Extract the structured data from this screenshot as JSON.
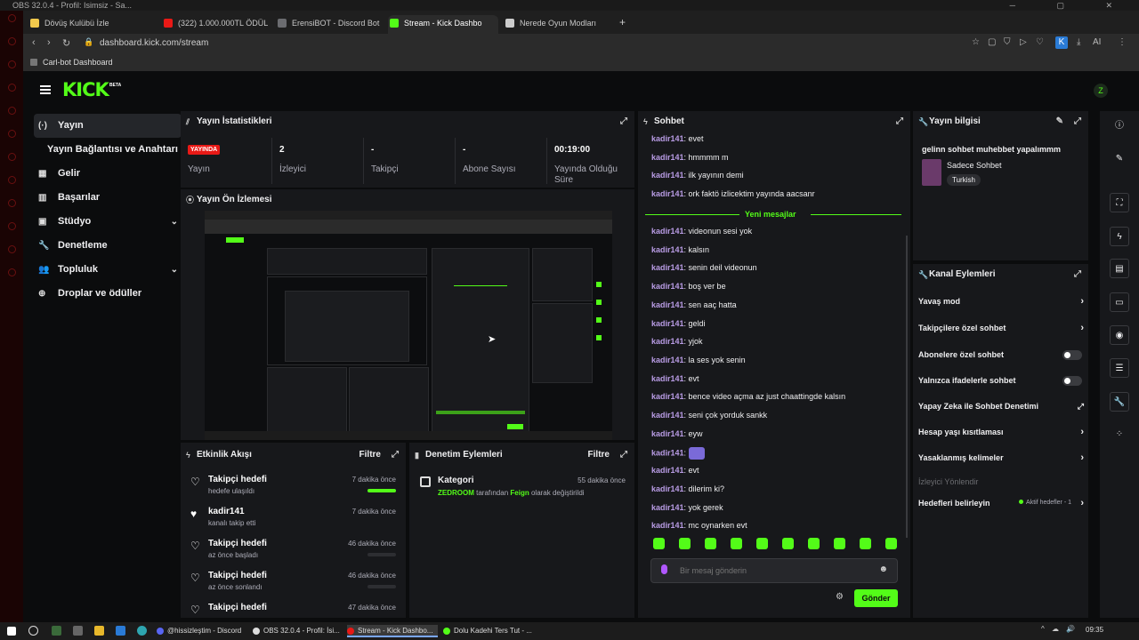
{
  "window_title": "OBS 32.0.4 - Profil: Isimsiz - Sa...",
  "browser": {
    "tabs": [
      {
        "label": "Dövüş Kulübü İzle",
        "color": "#f2c94c"
      },
      {
        "label": "(322) 1.000.000TL ÖDÜL",
        "color": "#e91916"
      },
      {
        "label": "ErensiBOT - Discord Bot",
        "color": "#6b6c70"
      },
      {
        "label": "Stream - Kick Dashbo",
        "color": "#53fc18"
      },
      {
        "label": "Nerede Oyun Modları",
        "color": "#cccccc"
      }
    ],
    "new_tab": "+",
    "url": "dashboard.kick.com/stream",
    "bookmark": "Carl-bot Dashboard"
  },
  "app": {
    "logo": "KICK",
    "beta": "BETA",
    "avatar_initial": "Z"
  },
  "sidebar": {
    "items": [
      {
        "label": "Yayın",
        "icon": "(·)",
        "active": true,
        "sub": false,
        "chevron": false
      },
      {
        "label": "Yayın Bağlantısı ve Anahtarı",
        "icon": "",
        "active": false,
        "sub": true,
        "chevron": false
      },
      {
        "label": "Gelir",
        "icon": "▦",
        "active": false,
        "sub": false,
        "chevron": false
      },
      {
        "label": "Başarılar",
        "icon": "▥",
        "active": false,
        "sub": false,
        "chevron": false
      },
      {
        "label": "Stüdyo",
        "icon": "▣",
        "active": false,
        "sub": false,
        "chevron": true
      },
      {
        "label": "Denetleme",
        "icon": "🔧",
        "active": false,
        "sub": false,
        "chevron": false
      },
      {
        "label": "Topluluk",
        "icon": "👥",
        "active": false,
        "sub": false,
        "chevron": true
      },
      {
        "label": "Droplar ve ödüller",
        "icon": "⊕",
        "active": false,
        "sub": false,
        "chevron": false
      }
    ]
  },
  "stats": {
    "title": "Yayın İstatistikleri",
    "live_badge": "YAYINDA",
    "items": [
      {
        "value": "2",
        "label": "İzleyici"
      },
      {
        "value": "-",
        "label": "Takipçi"
      },
      {
        "value": "-",
        "label": "Abone Sayısı"
      },
      {
        "value": "00:19:00",
        "label": "Yayında Olduğu Süre"
      }
    ],
    "live_label": "Yayın"
  },
  "preview": {
    "title": "Yayın Ön İzlemesi"
  },
  "activity": {
    "title": "Etkinlik Akışı",
    "filter": "Filtre",
    "events": [
      {
        "title": "Takipçi hedefi",
        "sub": "hedefe ulaşıldı",
        "time": "7 dakika önce",
        "progress": 1.0,
        "icon": "heart-outline"
      },
      {
        "title": "kadir141",
        "sub": "kanalı takip etti",
        "time": "7 dakika önce",
        "progress": null,
        "icon": "heart-filled"
      },
      {
        "title": "Takipçi hedefi",
        "sub": "az önce başladı",
        "time": "46 dakika önce",
        "progress": 0.0,
        "icon": "heart-outline"
      },
      {
        "title": "Takipçi hedefi",
        "sub": "az önce sonlandı",
        "time": "46 dakika önce",
        "progress": 0.0,
        "icon": "heart-outline"
      },
      {
        "title": "Takipçi hedefi",
        "sub": "",
        "time": "47 dakika önce",
        "progress": null,
        "icon": "heart-outline"
      }
    ]
  },
  "moderation": {
    "title": "Denetim Eylemleri",
    "filter": "Filtre",
    "entry": {
      "title": "Kategori",
      "time": "55 dakika önce",
      "actor": "ZEDROOM",
      "by": "tarafından",
      "target": "Feign",
      "action": "olarak değiştirildi"
    }
  },
  "chat": {
    "title": "Sohbet",
    "username": "kadir141",
    "messages_before": [
      "evet",
      "hmmmm m",
      "ilk yayının demi",
      "ork faktö izlicektim yayında aacsanr"
    ],
    "new_messages_label": "Yeni mesajlar",
    "messages_after": [
      "videonun sesi yok",
      "kalsın",
      "senin deil videonun",
      "boş ver be",
      "sen aaç hatta",
      "geldi",
      "yjok",
      "la ses yok senin",
      "evt",
      "bence video açma az just chaattingde kalsın",
      "seni çok yorduk sankk",
      "eyw",
      "[emote]",
      "evt",
      "dilerim ki?",
      "yok gerek",
      "mc oynarken evt"
    ],
    "input_placeholder": "Bir mesaj gönderin",
    "send_label": "Gönder"
  },
  "stream_info": {
    "title": "Yayın bilgisi",
    "stream_title": "gelinn sohbet muhebbet yapalımmm",
    "category": "Sadece Sohbet",
    "language": "Turkish"
  },
  "channel_actions": {
    "title": "Kanal Eylemleri",
    "items": [
      {
        "label": "Yavaş mod",
        "type": "chevron"
      },
      {
        "label": "Takipçilere özel sohbet",
        "type": "chevron"
      },
      {
        "label": "Abonelere özel sohbet",
        "type": "toggle"
      },
      {
        "label": "Yalnızca ifadelerle sohbet",
        "type": "toggle"
      },
      {
        "label": "Yapay Zeka ile Sohbet Denetimi",
        "type": "external"
      },
      {
        "label": "Hesap yaşı kısıtlaması",
        "type": "chevron"
      },
      {
        "label": "Yasaklanmış kelimeler",
        "type": "chevron"
      },
      {
        "label": "İzleyici Yönlendir",
        "type": "dim"
      },
      {
        "label": "Hedefleri belirleyin",
        "type": "goal"
      }
    ],
    "goal_status": "Aktif hedefler - 1"
  },
  "taskbar": {
    "items": [
      {
        "label": "@hissizleştim - Discord",
        "color": "#5865f2",
        "active": false
      },
      {
        "label": "OBS 32.0.4 - Profil: İsi...",
        "color": "#dddddd",
        "active": false
      },
      {
        "label": "Stream - Kick Dashbo...",
        "color": "#e91916",
        "active": true
      },
      {
        "label": "Dolu Kadehi Ters Tut - ...",
        "color": "#53fc18",
        "active": false
      }
    ],
    "clock": "09:35"
  },
  "colors": {
    "accent": "#53fc18",
    "panel": "#17181b",
    "live": "#e91916",
    "username": "#b99ce5"
  }
}
